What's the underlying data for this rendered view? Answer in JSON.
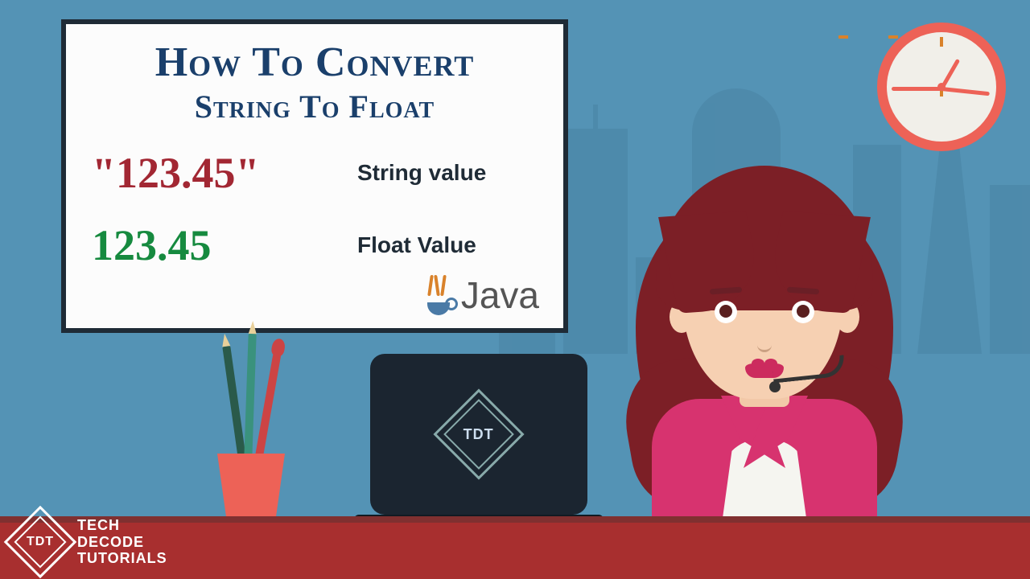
{
  "card": {
    "title_line1": "How To Convert",
    "title_line2": "String To Float",
    "string_value": "\"123.45\"",
    "string_label": "String value",
    "float_value": "123.45",
    "float_label": "Float Value",
    "language_label": "Java"
  },
  "laptop": {
    "logo_text": "TDT"
  },
  "brand": {
    "logo_text": "TDT",
    "line1": "TECH",
    "line2": "DECODE",
    "line3": "TUTORIALS"
  }
}
